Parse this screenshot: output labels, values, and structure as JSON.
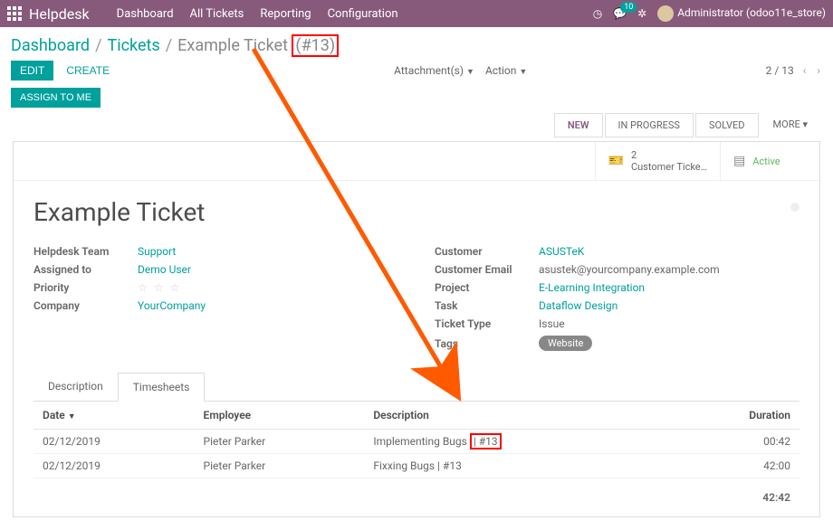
{
  "topbar": {
    "app": "Helpdesk",
    "menu": [
      "Dashboard",
      "All Tickets",
      "Reporting",
      "Configuration"
    ],
    "notif_count": "10",
    "user": "Administrator (odoo11e_store)"
  },
  "breadcrumb": {
    "a": "Dashboard",
    "b": "Tickets",
    "c_pre": "Example Ticket ",
    "c_id": "(#13)"
  },
  "toolbar": {
    "edit": "EDIT",
    "create": "CREATE",
    "attachments": "Attachment(s)",
    "action": "Action",
    "pager": "2 / 13",
    "assign": "ASSIGN TO ME"
  },
  "stages": [
    "NEW",
    "IN PROGRESS",
    "SOLVED",
    "MORE"
  ],
  "statboxes": {
    "tickets_n": "2",
    "tickets_l": "Customer Ticke…",
    "active": "Active"
  },
  "form": {
    "title": "Example Ticket",
    "left": {
      "team_l": "Helpdesk Team",
      "team_v": "Support",
      "assigned_l": "Assigned to",
      "assigned_v": "Demo User",
      "priority_l": "Priority",
      "company_l": "Company",
      "company_v": "YourCompany"
    },
    "right": {
      "customer_l": "Customer",
      "customer_v": "ASUSTeK",
      "email_l": "Customer Email",
      "email_v": "asustek@yourcompany.example.com",
      "project_l": "Project",
      "project_v": "E-Learning Integration",
      "task_l": "Task",
      "task_v": "Dataflow Design",
      "type_l": "Ticket Type",
      "type_v": "Issue",
      "tags_l": "Tags",
      "tags_v": "Website"
    }
  },
  "tabs": {
    "desc": "Description",
    "ts": "Timesheets"
  },
  "timesheets": {
    "cols": {
      "date": "Date",
      "emp": "Employee",
      "desc": "Description",
      "dur": "Duration"
    },
    "rows": [
      {
        "date": "02/12/2019",
        "emp": "Pieter Parker",
        "desc_pre": "Implementing Bugs ",
        "desc_id": "| #13",
        "dur": "00:42",
        "hl": true
      },
      {
        "date": "02/12/2019",
        "emp": "Pieter Parker",
        "desc_pre": "Fixxing Bugs | #13",
        "desc_id": "",
        "dur": "42:00",
        "hl": false
      }
    ],
    "total": "42:42"
  }
}
